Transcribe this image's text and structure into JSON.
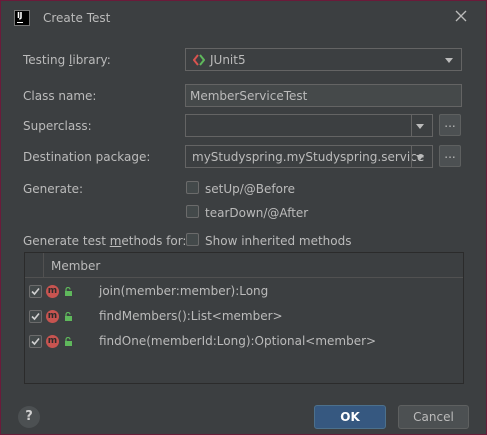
{
  "dialog": {
    "title": "Create Test",
    "app_icon_text": "IJ"
  },
  "form": {
    "testing_library_label_pre": "Testing ",
    "testing_library_label_mnemonic": "l",
    "testing_library_label_post": "ibrary:",
    "testing_library_value": "JUnit5",
    "class_name_label": "Class name:",
    "class_name_value": "MemberServiceTest",
    "superclass_label": "Superclass:",
    "superclass_value": "",
    "destination_label": "Destination package:",
    "destination_value": "myStudyspring.myStudyspring.service",
    "browse_label": "...",
    "generate_label": "Generate:",
    "setup_label": "setUp/@Before",
    "teardown_label": "tearDown/@After",
    "gen_methods_label_pre": "Generate test ",
    "gen_methods_label_mnemonic": "m",
    "gen_methods_label_post": "ethods for:",
    "show_inherited_label": "Show inherited methods"
  },
  "table": {
    "header": "Member",
    "badge": "m",
    "rows": [
      {
        "label": "join(member:member):Long",
        "checked": true
      },
      {
        "label": "findMembers():List<member>",
        "checked": true
      },
      {
        "label": "findOne(memberId:Long):Optional<member>",
        "checked": true
      }
    ]
  },
  "footer": {
    "help_label": "?",
    "ok_label": "OK",
    "cancel_label": "Cancel"
  },
  "colors": {
    "background": "#3c3f41",
    "accent_button": "#365880",
    "method_badge": "#c75450",
    "junit_red": "#d9534f",
    "junit_green": "#5fb85c"
  }
}
